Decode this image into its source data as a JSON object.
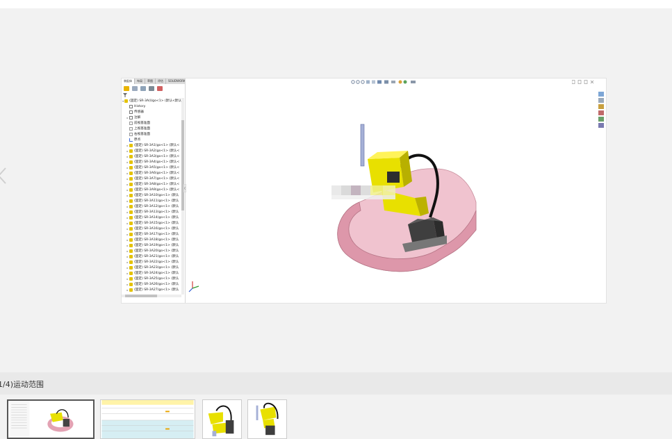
{
  "caption": {
    "text": "1/4)运动范围"
  },
  "sw_tabs": [
    "装配体",
    "布局",
    "草图",
    "评估",
    "SOLIDWORKS 插件",
    "SOLIDWORKS MBD",
    "共同工具箱"
  ],
  "tree": {
    "root_label": "(固定) SR-3A(Ugo<1> (默认<默认",
    "fixed_rows": [
      {
        "label": "History",
        "icon": "folder"
      },
      {
        "label": "传感器",
        "icon": "folder"
      },
      {
        "label": "注解",
        "icon": "folder",
        "expandable": true
      },
      {
        "label": "前视基准面",
        "icon": "plane"
      },
      {
        "label": "上视基准面",
        "icon": "plane"
      },
      {
        "label": "右视基准面",
        "icon": "plane"
      },
      {
        "label": "原点",
        "icon": "origin"
      }
    ],
    "part_rows": [
      "(固定) SR-3A1(go<1> (默认<",
      "(固定) SR-3A2(go<1> (默认<",
      "(固定) SR-3A3(go<1> (默认<",
      "(固定) SR-3A4(go<1> (默认<",
      "(固定) SR-3A5(go<1> (默认<",
      "(固定) SR-3A6(go<1> (默认<",
      "(固定) SR-3A7(go<1> (默认<",
      "(固定) SR-3A8(go<1> (默认<",
      "(固定) SR-3A9(go<1> (默认<",
      "(固定) SR-3A10(go<1> (默认",
      "(固定) SR-3A11(go<1> (默认",
      "(固定) SR-3A12(go<1> (默认",
      "(固定) SR-3A13(go<1> (默认",
      "(固定) SR-3A14(go<1> (默认",
      "(固定) SR-3A15(go<1> (默认",
      "(固定) SR-3A16(go<1> (默认",
      "(固定) SR-3A17(go<1> (默认",
      "(固定) SR-3A18(go<1> (默认",
      "(固定) SR-3A19(go<1> (默认",
      "(固定) SR-3A20(go<1> (默认",
      "(固定) SR-3A21(go<1> (默认",
      "(固定) SR-3A22(go<1> (默认",
      "(固定) SR-3A23(go<1> (默认",
      "(固定) SR-3A24(go<1> (默认",
      "(固定) SR-3A25(go<1> (默认",
      "(固定) SR-3A26(go<1> (默认",
      "(固定) SR-3A27(go<1> (默认"
    ]
  },
  "colors": {
    "robot_yellow": "#e8e000",
    "robot_base": "#4a4a4a",
    "range_band": "#e7a8b8",
    "cable": "#111111"
  },
  "thumbnails": [
    {
      "name": "thumbnail-robot-range",
      "selected": true
    },
    {
      "name": "thumbnail-spec-table",
      "selected": false
    },
    {
      "name": "thumbnail-robot-side",
      "selected": false
    },
    {
      "name": "thumbnail-robot-iso",
      "selected": false
    }
  ]
}
